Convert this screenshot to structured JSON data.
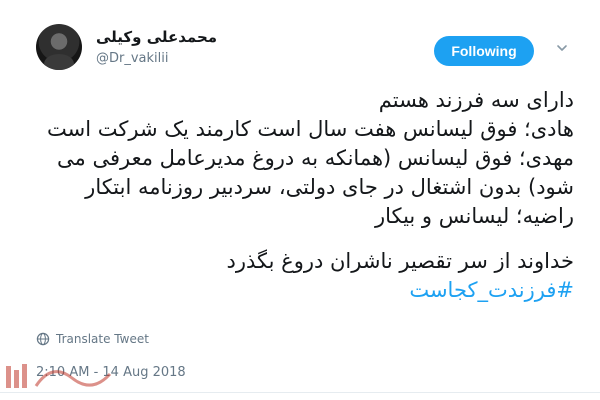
{
  "author": {
    "display_name": "محمدعلی وکیلی",
    "handle": "@Dr_vakilii"
  },
  "follow_button": {
    "label": "Following"
  },
  "tweet": {
    "lines": [
      "دارای سه فرزند هستم",
      "هادی؛ فوق لیسانس هفت سال است کارمند یک شرکت است",
      "مهدی؛ فوق لیسانس (همانکه به دروغ مدیرعامل معرفی می",
      "شود) بدون اشتغال در جای دولتی، سردبیر روزنامه ابتکار",
      "راضیه؛ لیسانس و بیکار",
      "خداوند از سر تقصیر ناشران دروغ بگذرد"
    ],
    "hashtag": "#فرزندت_کجاست"
  },
  "translate_label": "Translate Tweet",
  "timestamp": "2:10 AM - 14 Aug 2018",
  "colors": {
    "accent": "#1da1f2",
    "muted": "#657786",
    "text": "#14171a"
  },
  "icons": {
    "translate": "globe-icon",
    "menu": "chevron-down-icon"
  }
}
